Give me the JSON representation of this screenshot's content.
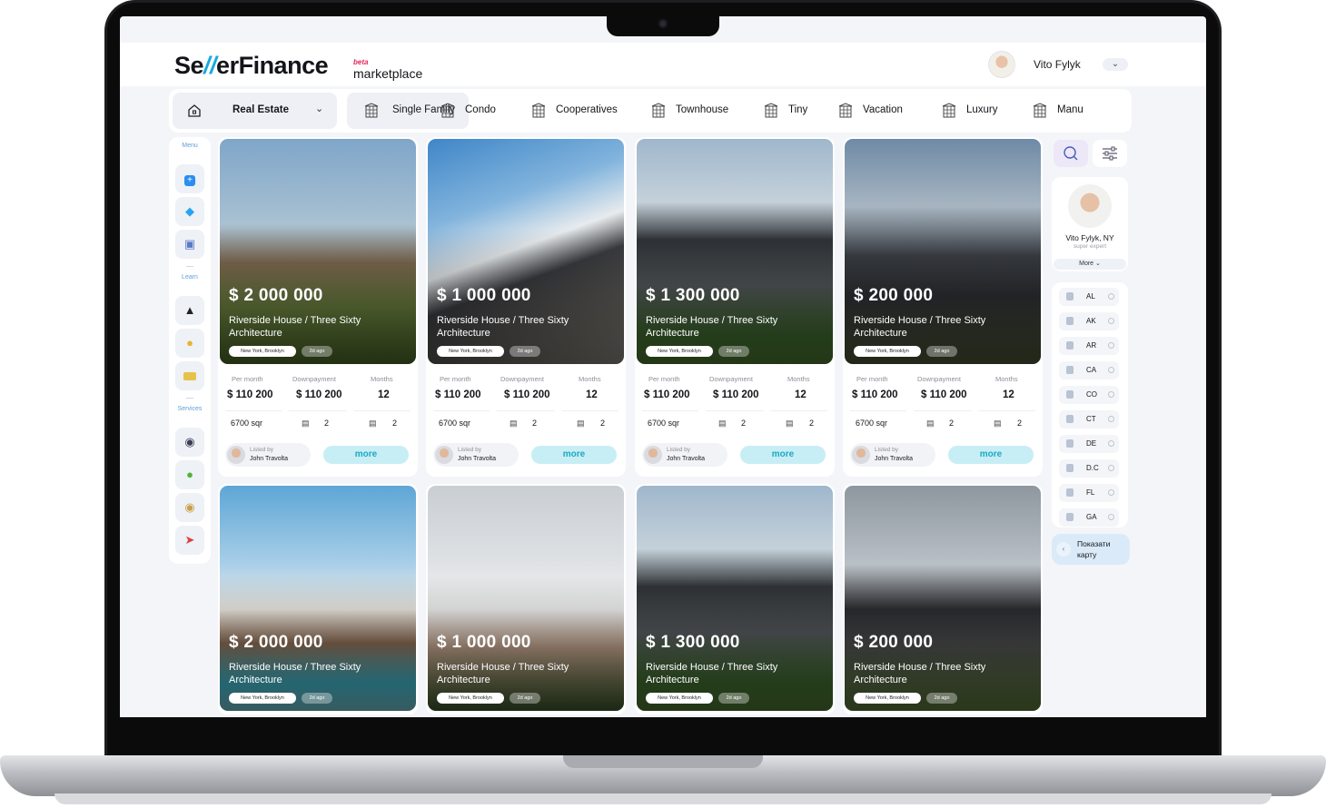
{
  "header": {
    "logo_left": "Se",
    "logo_slashes": "//",
    "logo_right": "erFinance",
    "logo_beta": "beta",
    "logo_marketplace": "marketplace",
    "user_name": "Vito Fylyk"
  },
  "categories": {
    "main_label": "Real Estate",
    "items": [
      {
        "label": "Single Family",
        "icon": "building-icon",
        "active": true
      },
      {
        "label": "Condo",
        "icon": "condo-icon"
      },
      {
        "label": "Cooperatives",
        "icon": "cooperatives-icon"
      },
      {
        "label": "Townhouse",
        "icon": "townhouse-icon"
      },
      {
        "label": "Tiny",
        "icon": "tiny-house-icon"
      },
      {
        "label": "Vacation",
        "icon": "vacation-icon"
      },
      {
        "label": "Luxury",
        "icon": "luxury-icon"
      },
      {
        "label": "Manu",
        "icon": "manufactured-icon"
      }
    ]
  },
  "left_menu": {
    "menu_title": "Menu",
    "learn_title": "Learn",
    "services_title": "Services",
    "menu_icons": [
      "plus-icon",
      "diamond-icon",
      "mailbox-icon"
    ],
    "learn_icons": [
      "graduation-cap-icon",
      "handshake-icon",
      "credit-card-icon"
    ],
    "services_icons": [
      "officer-icon",
      "apple-icon",
      "money-bag-icon",
      "rocket-icon"
    ]
  },
  "listings": [
    {
      "price": "$ 2 000 000",
      "title": "Riverside House / Three Sixty Architecture",
      "location": "New York, Brooklyn",
      "age": "2d ago",
      "per_month_label": "Per month",
      "per_month": "$ 110 200",
      "down_label": "Downpayment",
      "down": "$ 110 200",
      "months_label": "Months",
      "months": "12",
      "area": "6700 sqr",
      "beds": "2",
      "baths": "2",
      "listed_by_label": "Listed by",
      "lister": "John Travolta",
      "more_label": "more"
    },
    {
      "price": "$ 1 000 000",
      "title": "Riverside House / Three Sixty Architecture",
      "location": "New York, Brooklyn",
      "age": "2d ago",
      "per_month_label": "Per month",
      "per_month": "$ 110 200",
      "down_label": "Downpayment",
      "down": "$ 110 200",
      "months_label": "Months",
      "months": "12",
      "area": "6700 sqr",
      "beds": "2",
      "baths": "2",
      "listed_by_label": "Listed by",
      "lister": "John Travolta",
      "more_label": "more"
    },
    {
      "price": "$ 1 300 000",
      "title": "Riverside House / Three Sixty Architecture",
      "location": "New York, Brooklyn",
      "age": "2d ago",
      "per_month_label": "Per month",
      "per_month": "$ 110 200",
      "down_label": "Downpayment",
      "down": "$ 110 200",
      "months_label": "Months",
      "months": "12",
      "area": "6700 sqr",
      "beds": "2",
      "baths": "2",
      "listed_by_label": "Listed by",
      "lister": "John Travolta",
      "more_label": "more"
    },
    {
      "price": "$ 200 000",
      "title": "Riverside House / Three Sixty Architecture",
      "location": "New York, Brooklyn",
      "age": "2d ago",
      "per_month_label": "Per month",
      "per_month": "$ 110 200",
      "down_label": "Downpayment",
      "down": "$ 110 200",
      "months_label": "Months",
      "months": "12",
      "area": "6700 sqr",
      "beds": "2",
      "baths": "2",
      "listed_by_label": "Listed by",
      "lister": "John Travolta",
      "more_label": "more"
    },
    {
      "price": "$ 2 000 000",
      "title": "Riverside House / Three Sixty Architecture",
      "location": "New York, Brooklyn",
      "age": "2d ago"
    },
    {
      "price": "$ 1 000 000",
      "title": "Riverside House / Three Sixty Architecture",
      "location": "New York, Brooklyn",
      "age": "2d ago"
    },
    {
      "price": "$ 1 300 000",
      "title": "Riverside House / Three Sixty Architecture",
      "location": "New York, Brooklyn",
      "age": "2d ago"
    },
    {
      "price": "$ 200 000",
      "title": "Riverside House / Three Sixty Architecture",
      "location": "New York, Brooklyn",
      "age": "2d ago"
    }
  ],
  "right_panel": {
    "profile_name": "Vito Fylyk, NY",
    "profile_role": "super expert",
    "more_label": "More",
    "states": [
      "AL",
      "AK",
      "AR",
      "CA",
      "CO",
      "CT",
      "DE",
      "D.C",
      "FL",
      "GA"
    ],
    "map_label": "Показати карту"
  },
  "colors": {
    "accent_blue": "#1aa8e0",
    "beta_red": "#e2285a",
    "more_button": "#c7eef4"
  }
}
